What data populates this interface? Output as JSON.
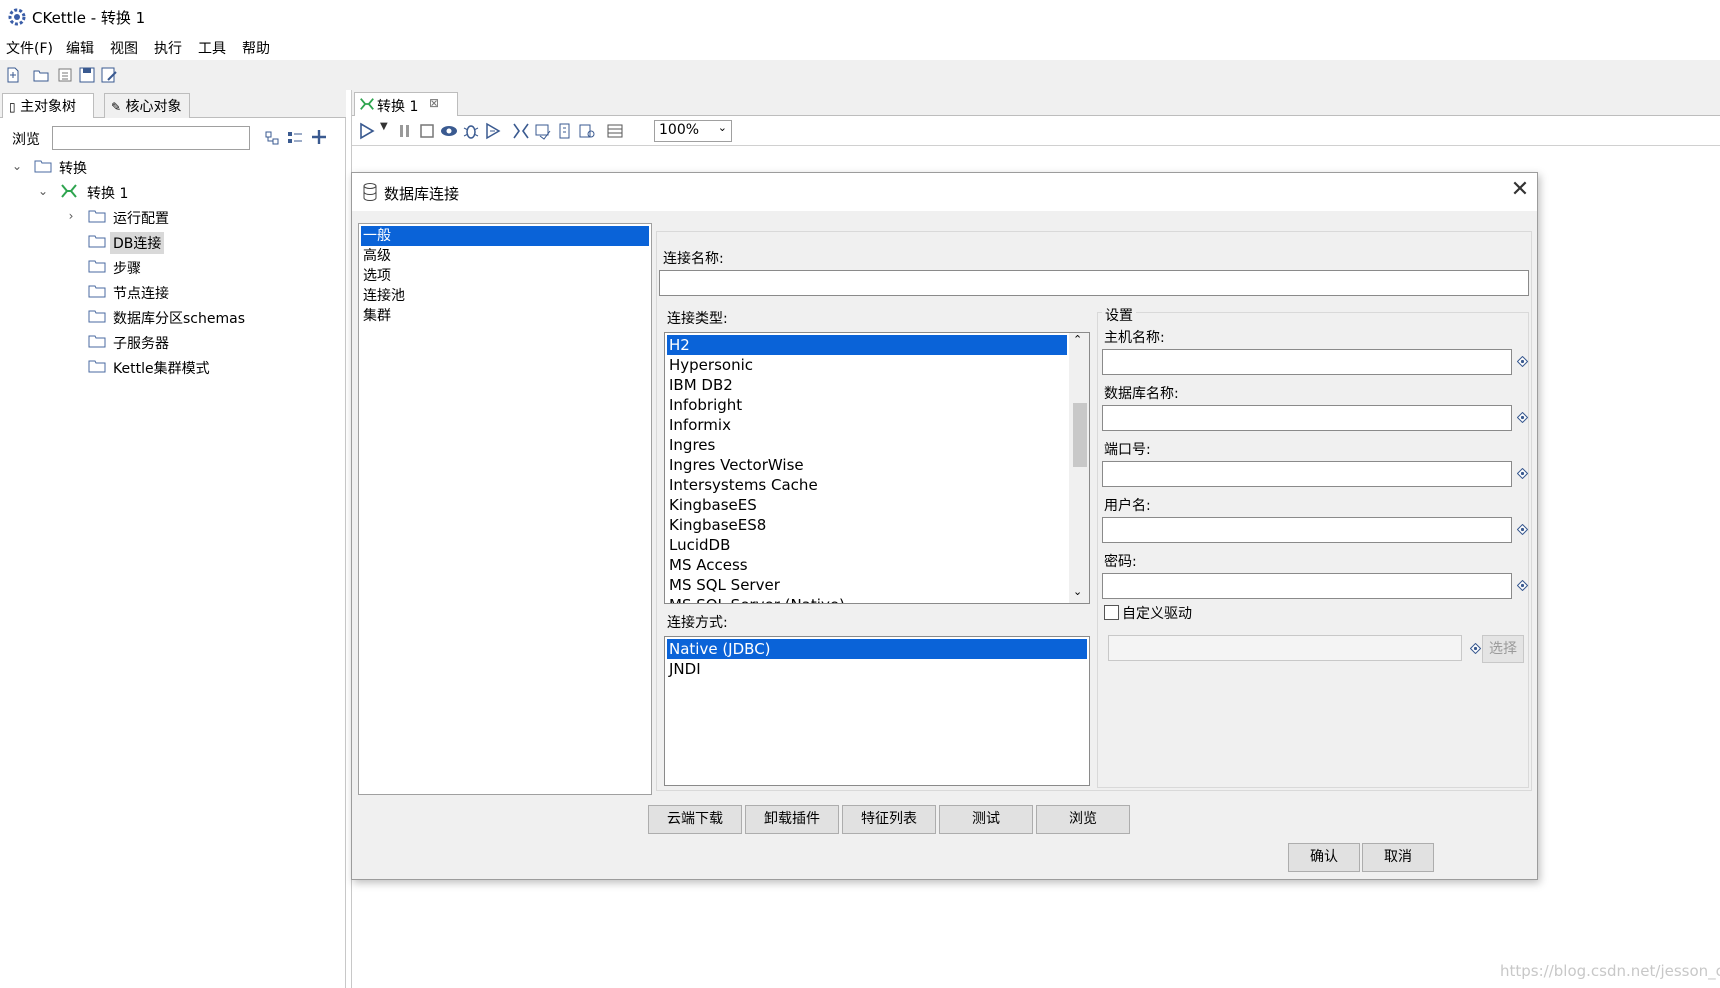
{
  "window": {
    "title": "CKettle - 转换 1"
  },
  "menu": [
    "文件(F)",
    "编辑",
    "视图",
    "执行",
    "工具",
    "帮助"
  ],
  "left_panel": {
    "tabs": [
      "主对象树",
      "核心对象"
    ],
    "browse_label": "浏览",
    "tree": {
      "root": "转换",
      "transform": "转换 1",
      "children": [
        "运行配置",
        "DB连接",
        "步骤",
        "节点连接",
        "数据库分区schemas",
        "子服务器",
        "Kettle集群模式"
      ]
    }
  },
  "editor": {
    "tab_label": "转换 1",
    "zoom": "100%"
  },
  "dialog": {
    "title": "数据库连接",
    "categories": [
      "一般",
      "高级",
      "选项",
      "连接池",
      "集群"
    ],
    "selected_category": "一般",
    "connection_name_label": "连接名称:",
    "connection_name_value": "",
    "connection_type_label": "连接类型:",
    "connection_types": [
      "H2",
      "Hypersonic",
      "IBM DB2",
      "Infobright",
      "Informix",
      "Ingres",
      "Ingres VectorWise",
      "Intersystems Cache",
      "KingbaseES",
      "KingbaseES8",
      "LucidDB",
      "MS Access",
      "MS SQL Server",
      "MS SQL Server (Native)"
    ],
    "selected_type": "H2",
    "access_label": "连接方式:",
    "access_methods": [
      "Native (JDBC)",
      "JNDI"
    ],
    "selected_access": "Native (JDBC)",
    "settings": {
      "group_title": "设置",
      "host_label": "主机名称:",
      "db_label": "数据库名称:",
      "port_label": "端口号:",
      "user_label": "用户名:",
      "password_label": "密码:",
      "custom_driver_label": "自定义驱动",
      "custom_driver_checked": false,
      "select_label": "选择"
    },
    "bottom_buttons": [
      "云端下载",
      "卸载插件",
      "特征列表",
      "测试",
      "浏览"
    ],
    "ok_label": "确认",
    "cancel_label": "取消"
  },
  "watermark": "https://blog.csdn.net/jesson_c",
  "colors": {
    "selection": "#0a63d8",
    "panel": "#f0f0f0",
    "kettle_green": "#2ea44f"
  }
}
